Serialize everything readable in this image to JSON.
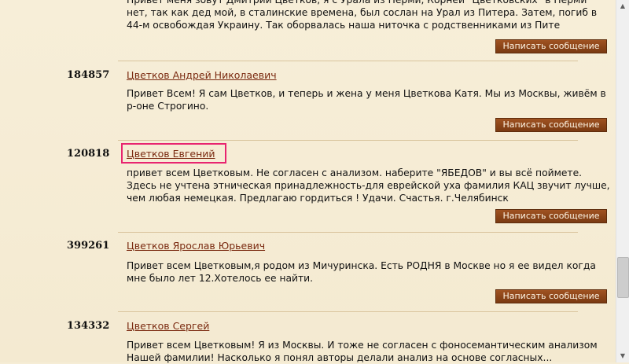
{
  "top_message": "Привет меня зовут Дмитрий Цветков, я с Урала из Перми, Корней \"Цветковских\" в Перми нет, так как дед мой, в сталинские времена, был сослан на Урал из Питера. Затем, погиб в 44-м освобождая Украину. Так оборвалась наша ниточка с родственниками из Пите",
  "button_label": "Написать сообщение",
  "entries": [
    {
      "id": "184857",
      "name": "Цветков Андрей Николаевич",
      "message": "Привет Всем! Я сам Цветков, и теперь и жена у меня Цветкова Катя. Мы из Москвы, живём в р-оне Строгино."
    },
    {
      "id": "120818",
      "name": "Цветков Евгений",
      "message": "привет всем Цветковым. Не согласен с анализом. наберите \"ЯБЕДОВ\" и вы всё поймете. Здесь не учтена этническая принадлежность-для еврейской уха фамилия КАЦ звучит лучше, чем любая немецкая. Предлагаю гордиться ! Удачи. Счастья. г.Челябинск"
    },
    {
      "id": "399261",
      "name": "Цветков Ярослав Юрьевич",
      "message": "Привет всем Цветковым,я родом из Мичуринска. Есть РОДНЯ в Москве но я ее видел когда мне было лет 12.Хотелось ее найти."
    },
    {
      "id": "134332",
      "name": "Цветков Сергей",
      "message": "Привет всем Цветковым! Я из Москвы. И тоже не согласен с фоносемантическим анализом Нашей фамилии! Насколько я понял авторы делали анализ на основе согласных..."
    }
  ],
  "colors": {
    "background": "#f6edd6",
    "link": "#7a2a10",
    "button": "#8a4418",
    "highlight": "#e8246f"
  }
}
